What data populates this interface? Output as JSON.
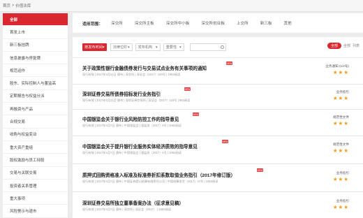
{
  "breadcrumb": {
    "home": "首页",
    "separator": ">",
    "current": "价值法库"
  },
  "sidebar": {
    "items": [
      {
        "label": "全部",
        "active": true
      },
      {
        "label": "首发上市"
      },
      {
        "label": "新三板挂牌"
      },
      {
        "label": "信息披露与停复牌"
      },
      {
        "label": "规范运作"
      },
      {
        "label": "股东、实际控制人与董监高"
      },
      {
        "label": "定期报告与权益分派"
      },
      {
        "label": "再融资与产品"
      },
      {
        "label": "合规交易"
      },
      {
        "label": "收购与权益变动"
      },
      {
        "label": "重大资产重组"
      },
      {
        "label": "股权激励与员工持股"
      },
      {
        "label": "交易与关联交易"
      },
      {
        "label": "投资者关系管理"
      },
      {
        "label": "重大事项"
      },
      {
        "label": "风险警示与退市"
      }
    ]
  },
  "filter": {
    "label": "适用范围：",
    "options": [
      "深交所",
      "深交所主板",
      "深交所中小板",
      "深交所创业板",
      "上交所",
      "新三板",
      "其他"
    ]
  },
  "toolbar": {
    "sort_label": "按发布时间",
    "selects": [
      "法律位阶",
      "发布机构",
      "重要性"
    ],
    "view_active": "全部",
    "view_option1": "全部",
    "view_option2": "列表"
  },
  "list": [
    {
      "title": "关于政策性银行金融债券发行与交易试点业务有关事项的通知",
      "meta": "现行有效 | 2017年4月11日 颁布 | 深交所 | 深证会〔2017〕120号 | 1063阅读",
      "new": true,
      "tag": "业务通知 (1/2号)",
      "stars": "★★★"
    },
    {
      "title": "深圳证券交易所债券招标发行业务指引",
      "meta": "现行有效 | 2017年4月11日 颁布 | 深圳证券交易所 | 深证会〔2017〕119号 | 983阅读",
      "new": true,
      "tag": "业务指引",
      "stars": "★★★"
    },
    {
      "title": "中国银监会关于银行业风险防控工作的指导意见",
      "meta": "现行有效 | 2017年4月7日 颁布 | 中国银监会 | 银监发〔2017〕6号 | 1063阅读",
      "new": true,
      "tag": "规范性文件",
      "stars": "★★★"
    },
    {
      "title": "中国银监会关于提升银行业服务实体经济质效的指导意见",
      "meta": "现行有效 | 2017年4月7日 颁布 | 中国银监会 | 银监发〔2017〕4号 | 1063阅读",
      "new": true,
      "tag": "规范性文件",
      "stars": "★★★"
    },
    {
      "title": "质押式回购资格准入标准及标准券折扣系数取值业务指引（2017年修订版）",
      "meta": "现行有效 | 2017年4月7日 颁布 | 中国证券登记结算有限责任公司 | 中国结算发字〔2017〕47号 | 1063阅读",
      "new": true,
      "tag": "业务指引",
      "stars": "★★★"
    },
    {
      "title": "深圳证券交易所独立董事备案办法（征求意见稿）",
      "meta": "现行有效 | 2017年4月7日 颁布 | 深交所 | 深证会〔2017〕 | 1063阅读",
      "new": false,
      "tag": "业务指引",
      "stars": "★★★"
    }
  ]
}
